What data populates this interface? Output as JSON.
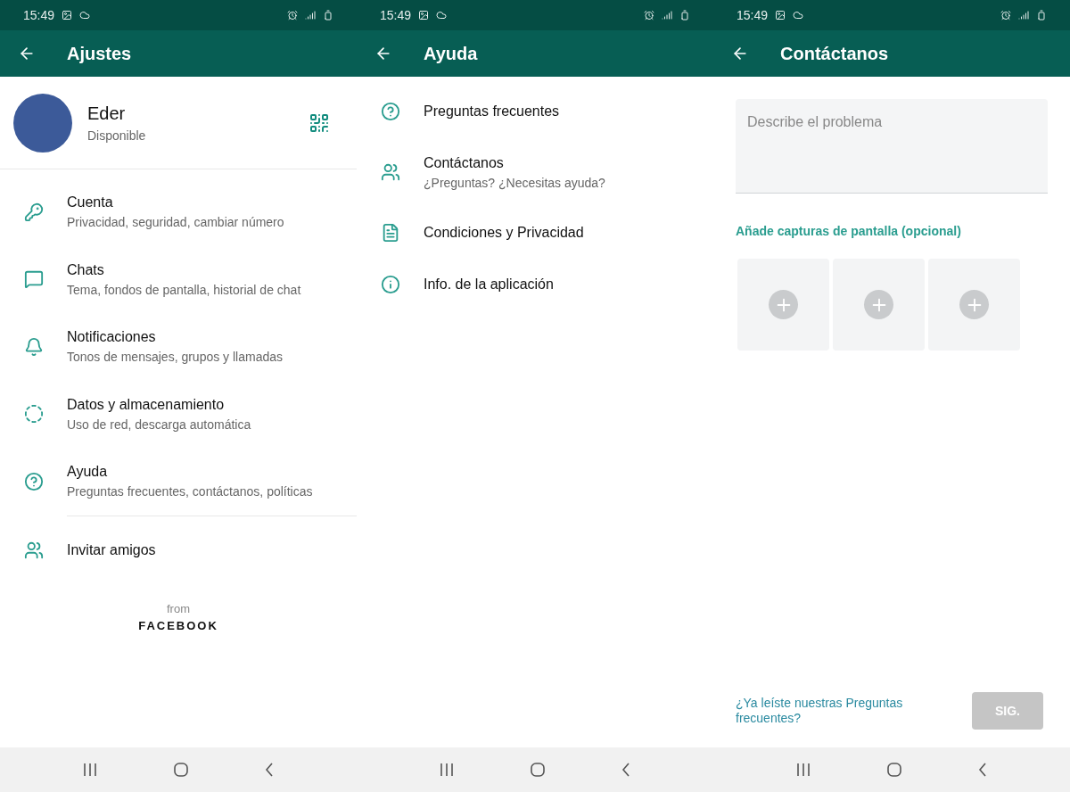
{
  "screens": [
    {
      "status_bar": {
        "time": "15:49"
      },
      "header": {
        "title": "Ajustes"
      },
      "profile": {
        "name": "Eder",
        "status": "Disponible"
      },
      "settings": [
        {
          "title": "Cuenta",
          "subtitle": "Privacidad, seguridad, cambiar número"
        },
        {
          "title": "Chats",
          "subtitle": "Tema, fondos de pantalla, historial de chat"
        },
        {
          "title": "Notificaciones",
          "subtitle": "Tonos de mensajes, grupos y llamadas"
        },
        {
          "title": "Datos y almacenamiento",
          "subtitle": "Uso de red, descarga automática"
        },
        {
          "title": "Ayuda",
          "subtitle": "Preguntas frecuentes, contáctanos, políticas"
        }
      ],
      "invite": "Invitar amigos",
      "footer": {
        "from": "from",
        "brand": "FACEBOOK"
      }
    },
    {
      "status_bar": {
        "time": "15:49"
      },
      "header": {
        "title": "Ayuda"
      },
      "help_items": [
        {
          "title": "Preguntas frecuentes"
        },
        {
          "title": "Contáctanos",
          "subtitle": "¿Preguntas? ¿Necesitas ayuda?"
        },
        {
          "title": "Condiciones y Privacidad"
        },
        {
          "title": "Info. de la aplicación"
        }
      ]
    },
    {
      "status_bar": {
        "time": "15:49"
      },
      "header": {
        "title": "Contáctanos"
      },
      "problem_field": {
        "placeholder": "Describe el problema"
      },
      "screenshots_label": "Añade capturas de pantalla (opcional)",
      "screenshot_slots": [
        {
          "filled": false
        },
        {
          "filled": false
        },
        {
          "filled": false
        }
      ],
      "faq_link": "¿Ya leíste nuestras Preguntas frecuentes?",
      "next_button": {
        "label": "SIG.",
        "disabled": true
      }
    }
  ]
}
